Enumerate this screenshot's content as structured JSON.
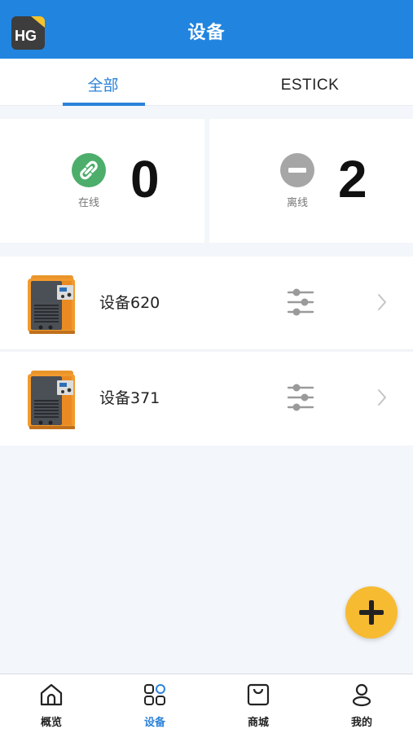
{
  "header": {
    "title": "设备",
    "logo_text": "HG"
  },
  "tabs": [
    {
      "label": "全部",
      "active": true
    },
    {
      "label": "ESTICK",
      "active": false
    }
  ],
  "status": {
    "online": {
      "label": "在线",
      "count": "0",
      "icon": "link-icon",
      "color": "#4cae6a"
    },
    "offline": {
      "label": "离线",
      "count": "2",
      "icon": "minus-circle-icon",
      "color": "#a6a6a6"
    }
  },
  "devices": [
    {
      "name": "设备620",
      "icon": "welder-machine-image"
    },
    {
      "name": "设备371",
      "icon": "welder-machine-image"
    }
  ],
  "fab": {
    "icon": "plus-icon",
    "color": "#f7bb32"
  },
  "nav": [
    {
      "label": "概览",
      "icon": "home-icon",
      "active": false
    },
    {
      "label": "设备",
      "icon": "devices-grid-icon",
      "active": true
    },
    {
      "label": "商城",
      "icon": "shopping-bag-icon",
      "active": false
    },
    {
      "label": "我的",
      "icon": "user-icon",
      "active": false
    }
  ],
  "colors": {
    "primary": "#2185e0",
    "accent": "#2b82d9",
    "background": "#f3f6fa"
  }
}
